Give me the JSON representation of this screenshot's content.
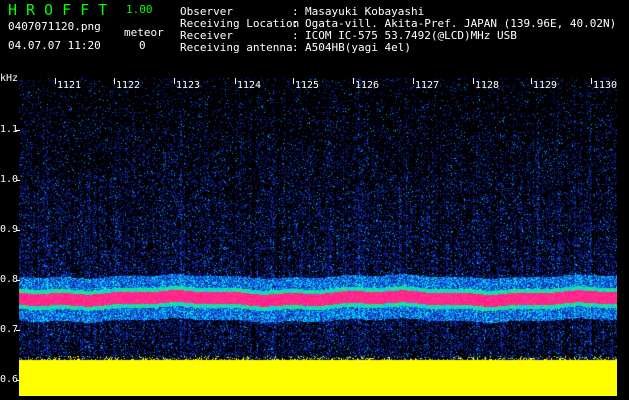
{
  "app": {
    "title": "HROFFT",
    "version": "1.00"
  },
  "file": {
    "name": "0407071120.png",
    "datetime": "04.07.07 11:20"
  },
  "meteor": {
    "label": "meteor",
    "count": "0"
  },
  "info": [
    {
      "label": "Observer",
      "value": "Masayuki Kobayashi"
    },
    {
      "label": "Receiving Location",
      "value": "Ogata-vill. Akita-Pref. JAPAN (139.96E, 40.02N)"
    },
    {
      "label": "Receiver",
      "value": "ICOM IC-575 53.7492(@LCD)MHz USB"
    },
    {
      "label": "Receiving antenna",
      "value": "A504HB(yagi 4el)"
    }
  ],
  "separator": ":",
  "axis": {
    "freq_unit": "kHz",
    "freq_labels": [
      "1.1",
      "1.0",
      "0.9",
      "0.8",
      "0.7",
      "0.6"
    ],
    "time_labels": [
      "1121",
      "1122",
      "1123",
      "1124",
      "1125",
      "1126",
      "1127",
      "1128",
      "1129",
      "1130"
    ]
  },
  "colors": {
    "accent_green": "#00ff00",
    "noise_blue": "#1030c0",
    "signal_magenta": "#ff2080",
    "baseline_yellow": "#ffff00"
  }
}
